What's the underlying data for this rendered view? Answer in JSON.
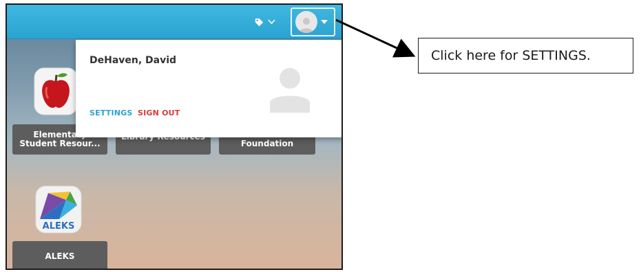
{
  "header": {
    "tag_icon": "tag-icon",
    "tag_chevron": "⌄",
    "avatar_icon": "user-avatar-icon"
  },
  "tiles": [
    {
      "line1": "Elementary",
      "line2": "Student Resour..."
    },
    {
      "line1": "Library Resources",
      "line2": ""
    },
    {
      "line1": "Foundation",
      "line2": ""
    },
    {
      "line1": "ALEKS",
      "line2": ""
    }
  ],
  "aleks_logo_text": "ALEKS",
  "dropdown": {
    "user_name": "DeHaven, David",
    "settings_label": "SETTINGS",
    "signout_label": "SIGN OUT"
  },
  "callout": {
    "text": "Click here for SETTINGS."
  },
  "colors": {
    "accent": "#2aa3d2",
    "signout": "#d9383a",
    "tile": "#5d5d5d"
  }
}
